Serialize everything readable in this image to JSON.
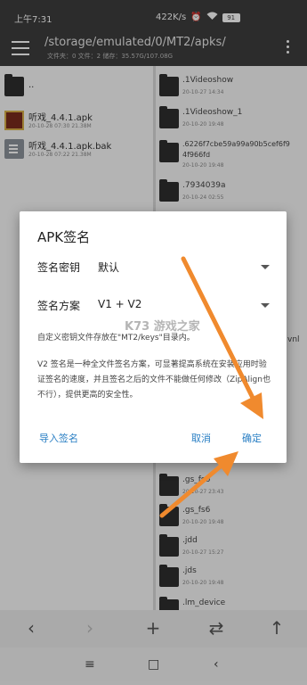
{
  "status_bar": {
    "time": "上午7:31",
    "speed": "422K/s",
    "battery": "91"
  },
  "app_bar": {
    "path": "/storage/emulated/0/MT2/apks/",
    "info": "文件夹：0  文件：2  储存：35.57G/107.08G"
  },
  "left_pane": {
    "files": [
      {
        "name": "..",
        "meta": "",
        "type": "folder"
      },
      {
        "name": "听戏_4.4.1.apk",
        "meta": "20-10-28 07:30  21.38M",
        "type": "apk"
      },
      {
        "name": "听戏_4.4.1.apk.bak",
        "meta": "20-10-28 07:22  21.38M",
        "type": "bak"
      }
    ]
  },
  "right_pane": {
    "files": [
      {
        "name": ".1Videoshow",
        "meta": "20-10-27 14:34"
      },
      {
        "name": ".1Videoshow_1",
        "meta": "20-10-20 19:48"
      },
      {
        "name": ".6226f7cbe59a99a90b5cef6f9",
        "name2": "4f966fd",
        "meta": "20-10-20 19:48"
      },
      {
        "name": ".7934039a",
        "meta": "20-10-24 02:55"
      },
      {
        "name": ".gs_fs6",
        "meta": "20-10-27 23:43"
      },
      {
        "name": ".gs_fs6",
        "meta": "20-10-20 19:48"
      },
      {
        "name": ".jdd",
        "meta": "20-10-27 15:27"
      },
      {
        "name": ".jds",
        "meta": "20-10-20 19:48"
      },
      {
        "name": ".lm_device",
        "meta": ""
      }
    ],
    "partial_label": "vnl"
  },
  "dialog": {
    "title": "APK签名",
    "signing_key_label": "签名密钥",
    "signing_key_value": "默认",
    "scheme_label": "签名方案",
    "scheme_value": "V1 + V2",
    "desc1": "自定义密钥文件存放在\"MT2/keys\"目录内。",
    "desc2": "V2 签名是一种全文件签名方案，可显著提高系统在安装应用时验证签名的速度，并且签名之后的文件不能做任何修改（ZipAlign也不行），提供更高的安全性。",
    "import_label": "导入签名",
    "cancel_label": "取消",
    "ok_label": "确定"
  },
  "watermark": "K73 游戏之家",
  "toolbar": {
    "back": "‹",
    "forward": "›",
    "add": "+",
    "swap": "⇄",
    "up": "↑"
  },
  "nav": {
    "menu": "≡",
    "home": "□",
    "back": "‹"
  },
  "colors": {
    "accent": "#2a7fc4",
    "bar": "#3d3d3d",
    "arrow": "#f08a2e"
  }
}
